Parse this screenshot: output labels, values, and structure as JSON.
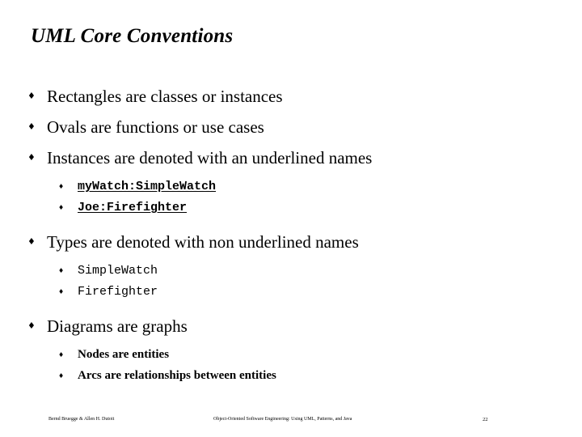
{
  "slide": {
    "title": "UML Core Conventions",
    "page_number": "22",
    "background_color": "#ffffff",
    "text_color": "#000000",
    "bullet_level1_glyph": "♦",
    "bullet_level2_glyph": "♦"
  },
  "content": {
    "items": [
      {
        "level": 1,
        "style": "serif",
        "text": "Rectangles are classes or instances"
      },
      {
        "level": 1,
        "style": "serif",
        "text": "Ovals are functions or use cases"
      },
      {
        "level": 1,
        "style": "serif",
        "text": "Instances are denoted with an underlined names"
      },
      {
        "level": 2,
        "style": "mono-bold-underline",
        "text": "myWatch:SimpleWatch"
      },
      {
        "level": 2,
        "style": "mono-bold-underline",
        "text": "Joe:Firefighter"
      },
      {
        "level": 1,
        "style": "serif",
        "text": "Types are denoted with non underlined names"
      },
      {
        "level": 2,
        "style": "mono",
        "text": "SimpleWatch"
      },
      {
        "level": 2,
        "style": "mono",
        "text": "Firefighter"
      },
      {
        "level": 1,
        "style": "serif",
        "text": "Diagrams are graphs"
      },
      {
        "level": 2,
        "style": "serif-bold",
        "text": "Nodes are entities"
      },
      {
        "level": 2,
        "style": "serif-bold",
        "text": "Arcs are relationships between entities"
      }
    ]
  },
  "footer": {
    "authors": "Bernd Bruegge & Allen H. Dutoit",
    "book_title": "Object-Oriented Software Engineering: Using UML, Patterns, and Java",
    "page": "22"
  }
}
